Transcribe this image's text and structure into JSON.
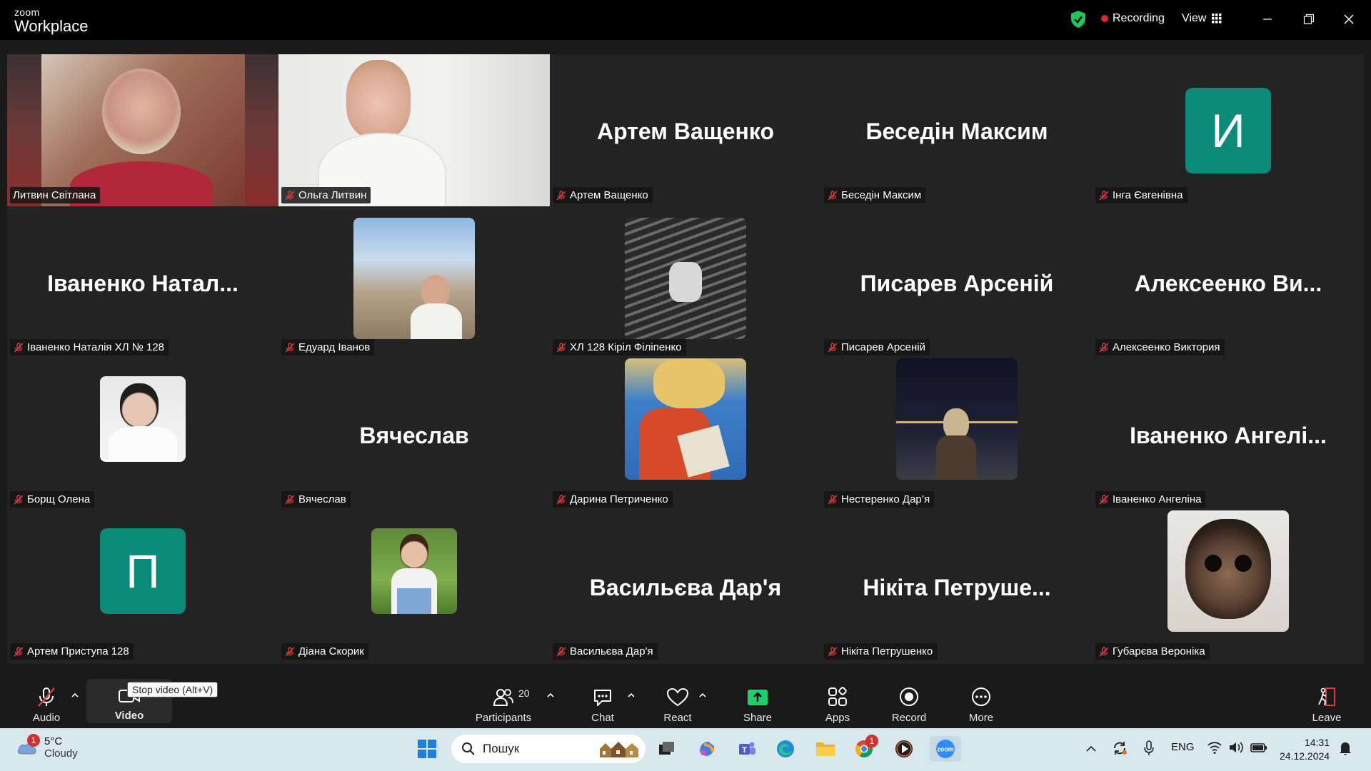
{
  "app": {
    "brand_small": "zoom",
    "brand_big": "Workplace"
  },
  "header": {
    "recording_label": "Recording",
    "view_label": "View"
  },
  "tiles": [
    {
      "name": "Литвин Світлана",
      "kind": "video",
      "muted": false
    },
    {
      "name": "Ольга Литвин",
      "kind": "video",
      "muted": true
    },
    {
      "name": "Артем Ващенко",
      "kind": "text",
      "display": "Артем Ващенко",
      "muted": true
    },
    {
      "name": "Беседін Максим",
      "kind": "text",
      "display": "Беседін Максим",
      "muted": true
    },
    {
      "name": "Інга Євгенівна",
      "kind": "avatar",
      "letter": "И",
      "muted": true
    },
    {
      "name": "Іваненко Наталія ХЛ № 128",
      "kind": "text",
      "display": "Іваненко  Натал...",
      "muted": true
    },
    {
      "name": "Едуард Іванов",
      "kind": "photo",
      "muted": true
    },
    {
      "name": "ХЛ 128 Кіріл Філіпенко",
      "kind": "photo",
      "muted": true
    },
    {
      "name": "Писарев Арсеній",
      "kind": "text",
      "display": "Писарев Арсеній",
      "muted": true
    },
    {
      "name": "Алексеенко Виктория",
      "kind": "text",
      "display": "Алексеенко  Ви...",
      "muted": true
    },
    {
      "name": "Борщ Олена",
      "kind": "photo",
      "muted": true
    },
    {
      "name": "Вячеслав",
      "kind": "text",
      "display": "Вячеслав",
      "muted": true
    },
    {
      "name": "Дарина Петриченко",
      "kind": "photo",
      "muted": true
    },
    {
      "name": "Нестеренко Дар’я",
      "kind": "photo",
      "muted": true
    },
    {
      "name": "Іваненко Ангеліна",
      "kind": "text",
      "display": "Іваненко  Ангелі...",
      "muted": true
    },
    {
      "name": "Артем Приступа 128",
      "kind": "avatar",
      "letter": "П",
      "muted": true
    },
    {
      "name": "Діана Скорик",
      "kind": "photo",
      "muted": true
    },
    {
      "name": "Васильєва Дар'я",
      "kind": "text",
      "display": "Васильєва Дар'я",
      "muted": true
    },
    {
      "name": "Нікіта Петрушенко",
      "kind": "text",
      "display": "Нікіта  Петруше...",
      "muted": true
    },
    {
      "name": "Губарєва Вероніка",
      "kind": "photo",
      "muted": true
    }
  ],
  "toolbar": {
    "audio": "Audio",
    "video": "Video",
    "video_tooltip": "Stop video (Alt+V)",
    "participants": "Participants",
    "participants_count": "20",
    "chat": "Chat",
    "react": "React",
    "share": "Share",
    "apps": "Apps",
    "record": "Record",
    "more": "More",
    "leave": "Leave"
  },
  "taskbar": {
    "weather_temp": "5°C",
    "weather_desc": "Cloudy",
    "weather_badge": "1",
    "search_placeholder": "Пошук",
    "chrome_badge": "1",
    "lang": "ENG",
    "time": "14:31",
    "date": "24.12.2024"
  },
  "colors": {
    "active_speaker": "#27d07b",
    "avatar_bg": "#0a8a78",
    "share_green": "#1fcf6b",
    "recording_dot": "#e02828"
  }
}
